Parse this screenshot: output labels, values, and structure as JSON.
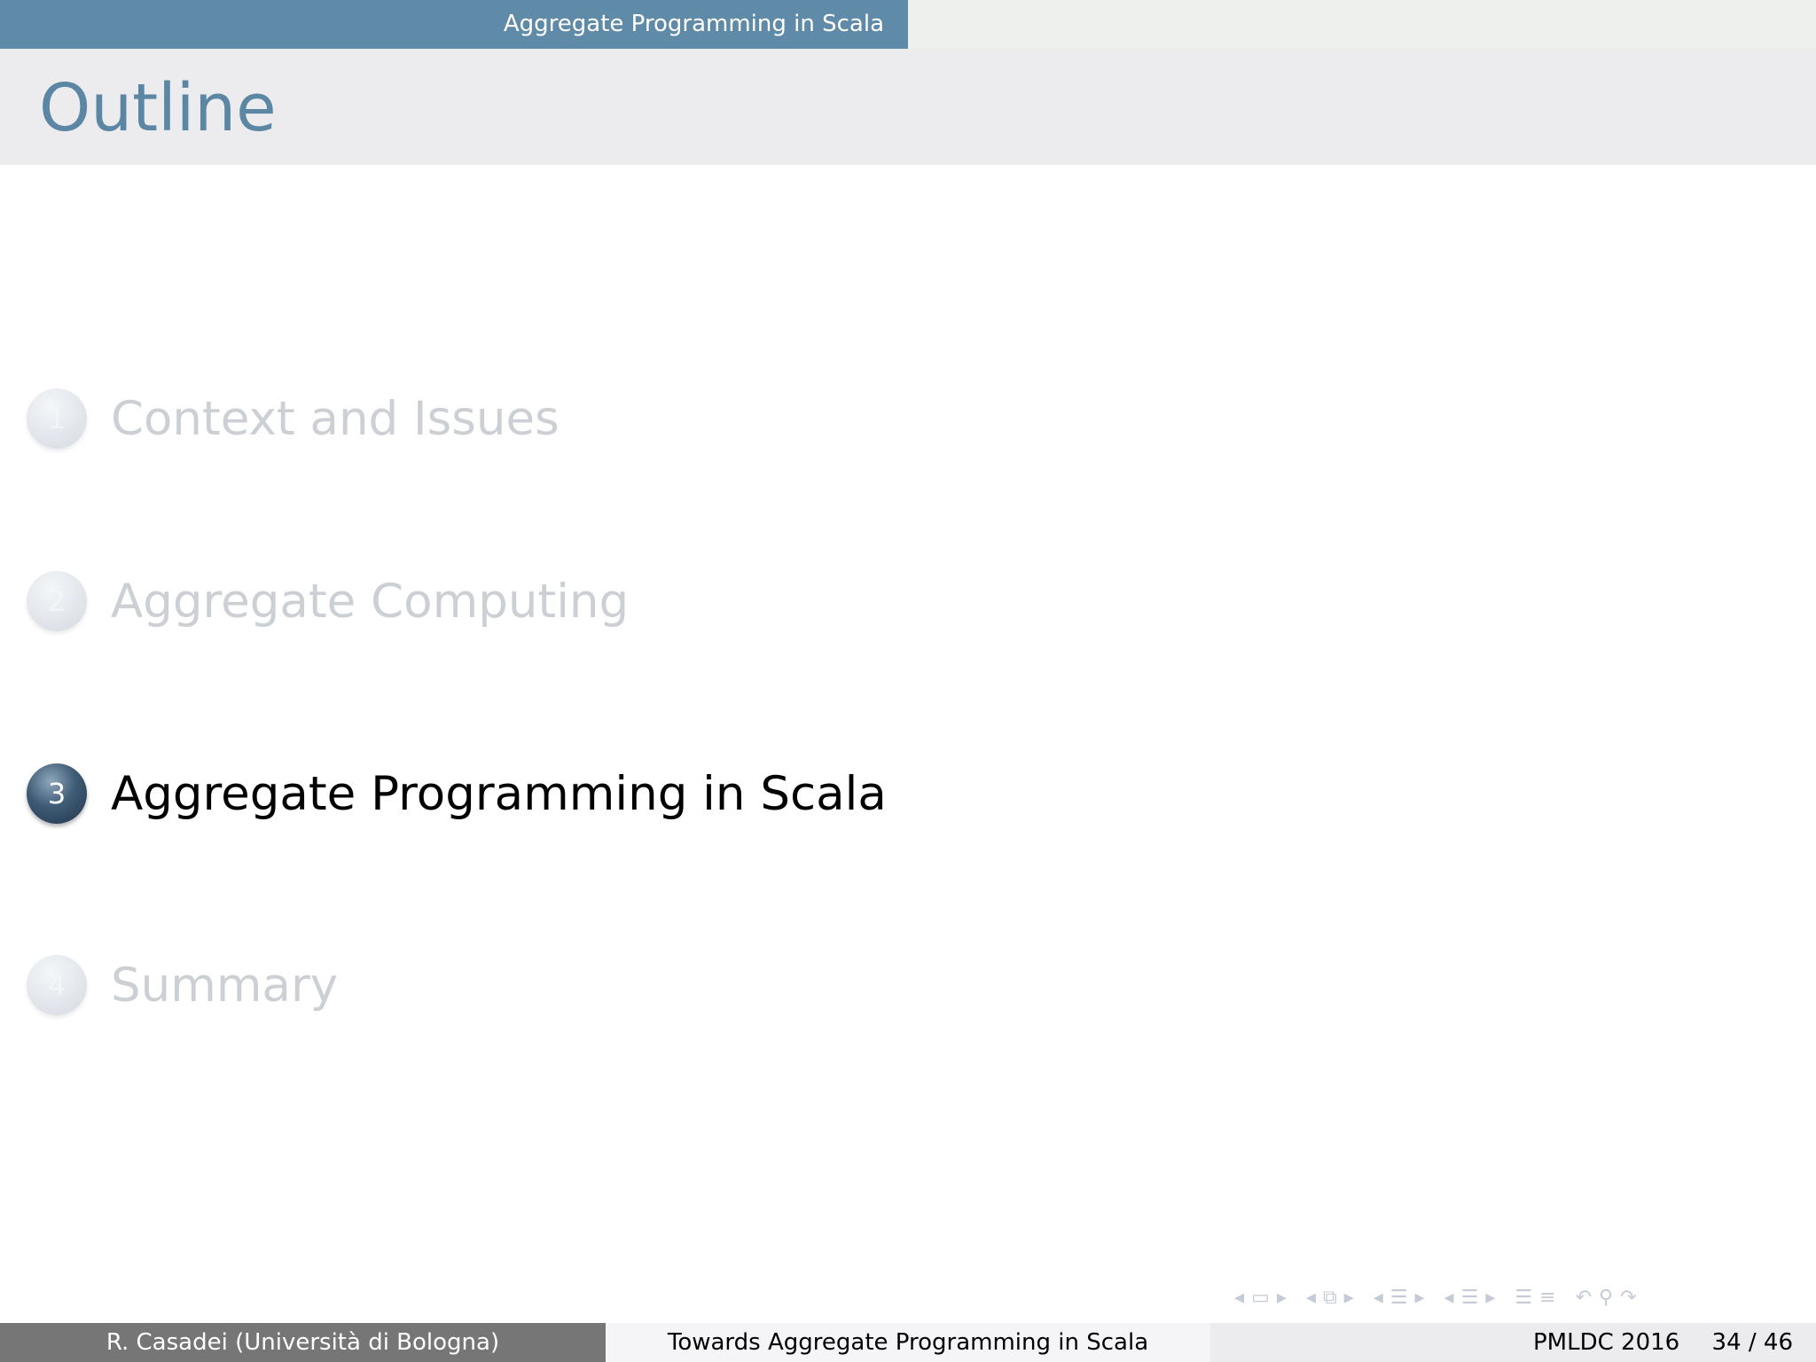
{
  "header": {
    "section_nav": "Aggregate Programming in Scala"
  },
  "frame": {
    "title": "Outline"
  },
  "outline": {
    "items": [
      {
        "number": "1",
        "label": "Context and Issues",
        "state": "shaded"
      },
      {
        "number": "2",
        "label": "Aggregate Computing",
        "state": "shaded"
      },
      {
        "number": "3",
        "label": "Aggregate Programming in Scala",
        "state": "current"
      },
      {
        "number": "4",
        "label": "Summary",
        "state": "shaded"
      }
    ]
  },
  "footer": {
    "author": "R. Casadei  (Università di Bologna)",
    "title": "Towards Aggregate Programming in Scala",
    "event": "PMLDC 2016",
    "page": "34 / 46"
  },
  "nav_icons": [
    "prev-frame-icon",
    "frame-icon",
    "next-frame-icon",
    "prev-subsection-icon",
    "subsection-icon",
    "next-subsection-icon",
    "prev-section-icon",
    "section-icon",
    "next-section-icon",
    "prev-document-icon",
    "document-icon",
    "next-document-icon",
    "appendix-icon",
    "back-icon",
    "search-icon",
    "forward-icon"
  ],
  "colors": {
    "accent": "#5f8aa8",
    "title": "#5b87a5",
    "shaded_text": "#cccfd4",
    "footer_author_bg": "#767676"
  }
}
